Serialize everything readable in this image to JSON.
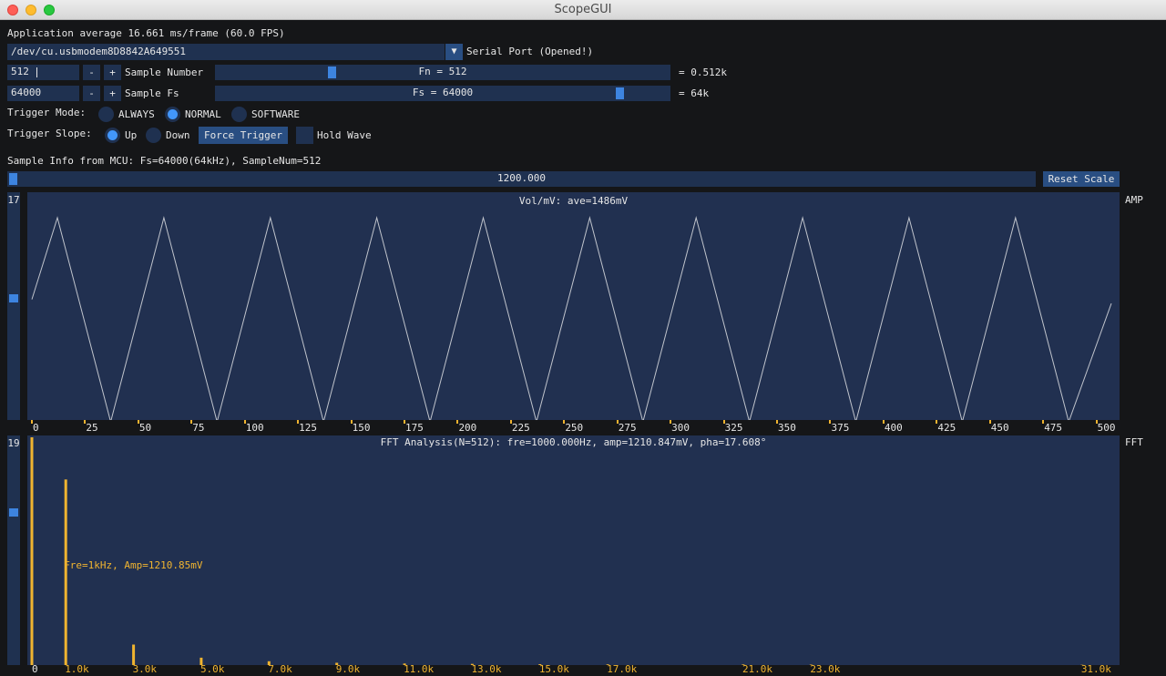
{
  "window": {
    "title": "ScopeGUI"
  },
  "app": {
    "fps_line": "Application average 16.661 ms/frame (60.0 FPS)"
  },
  "serial": {
    "port": "/dev/cu.usbmodem8D8842A649551",
    "label": "Serial Port (Opened!)",
    "dropdown_icon": "triangle-down-icon"
  },
  "sample_number": {
    "input": "512",
    "minus": "-",
    "plus": "+",
    "label": "Sample Number",
    "slider_text": "Fn = 512",
    "slider_level": 0.25,
    "result": "= 0.512k"
  },
  "sample_fs": {
    "input": "64000",
    "minus": "-",
    "plus": "+",
    "label": "Sample Fs",
    "slider_text": "Fs = 64000",
    "slider_level": 0.9,
    "result": "= 64k"
  },
  "trigger_mode": {
    "label": "Trigger Mode:",
    "options": [
      {
        "label": "ALWAYS",
        "selected": false
      },
      {
        "label": "NORMAL",
        "selected": true
      },
      {
        "label": "SOFTWARE",
        "selected": false
      }
    ]
  },
  "trigger_slope": {
    "label": "Trigger Slope:",
    "options": [
      {
        "label": "Up",
        "selected": true
      },
      {
        "label": "Down",
        "selected": false
      }
    ],
    "force_button": "Force Trigger",
    "hold_label": "Hold Wave",
    "hold_checked": false
  },
  "sample_info": "Sample Info from MCU: Fs=64000(64kHz), SampleNum=512",
  "scale": {
    "value": "1200.000",
    "level": 0.0,
    "reset": "Reset Scale"
  },
  "colors": {
    "accent": "#4296fa",
    "plot_bg": "#213050",
    "fft_bar": "#f0b430",
    "wave": "#c0c4cc"
  },
  "amp_plot": {
    "slider_value": "17",
    "side_label": "AMP",
    "title": "Vol/mV: ave=1486mV",
    "chart_data": {
      "type": "line",
      "title": "Vol/mV: ave=1486mV",
      "x_ticks": [
        "0",
        "25",
        "50",
        "75",
        "100",
        "125",
        "150",
        "175",
        "200",
        "225",
        "250",
        "275",
        "300",
        "325",
        "350",
        "375",
        "400",
        "425",
        "450",
        "475",
        "500"
      ],
      "xlim": [
        0,
        510
      ],
      "ylim": [
        0,
        1
      ],
      "series": [
        {
          "x": [
            0,
            12,
            37,
            62,
            87,
            112,
            137,
            162,
            187,
            212,
            237,
            262,
            287,
            312,
            337,
            362,
            387,
            412,
            437,
            462,
            487,
            507
          ],
          "y": [
            0.6,
            1,
            0,
            1,
            0,
            1,
            0,
            1,
            0,
            1,
            0,
            1,
            0,
            1,
            0,
            1,
            0,
            1,
            0,
            1,
            0,
            0.58
          ]
        }
      ]
    }
  },
  "fft_plot": {
    "slider_value": "19",
    "side_label": "FFT",
    "title": "FFT Analysis(N=512): fre=1000.000Hz, amp=1210.847mV, pha=17.608°",
    "annotation": "Fre=1kHz, Amp=1210.85mV",
    "chart_data": {
      "type": "bar",
      "title": "FFT Analysis(N=512): fre=1000.000Hz, amp=1210.847mV, pha=17.608°",
      "x_ticks": [
        "0",
        "1.0k",
        "3.0k",
        "5.0k",
        "7.0k",
        "9.0k",
        "11.0k",
        "13.0k",
        "15.0k",
        "17.0k",
        "21.0k",
        "23.0k",
        "31.0k"
      ],
      "tick_freqs": [
        0,
        1,
        3,
        5,
        7,
        9,
        11,
        13,
        15,
        17,
        21,
        23,
        31
      ],
      "xlim": [
        0,
        32
      ],
      "ylim": [
        0,
        1486
      ],
      "bars": [
        {
          "freq_khz": 0,
          "amp_mv": 1486
        },
        {
          "freq_khz": 1,
          "amp_mv": 1210.85
        },
        {
          "freq_khz": 3,
          "amp_mv": 134
        },
        {
          "freq_khz": 5,
          "amp_mv": 48
        },
        {
          "freq_khz": 7,
          "amp_mv": 25
        },
        {
          "freq_khz": 9,
          "amp_mv": 15
        },
        {
          "freq_khz": 11,
          "amp_mv": 10
        },
        {
          "freq_khz": 13,
          "amp_mv": 8
        },
        {
          "freq_khz": 15,
          "amp_mv": 6
        },
        {
          "freq_khz": 17,
          "amp_mv": 5
        },
        {
          "freq_khz": 21,
          "amp_mv": 4
        },
        {
          "freq_khz": 23,
          "amp_mv": 3
        },
        {
          "freq_khz": 31,
          "amp_mv": 2
        }
      ],
      "annotation": "Fre=1kHz, Amp=1210.85mV"
    }
  }
}
